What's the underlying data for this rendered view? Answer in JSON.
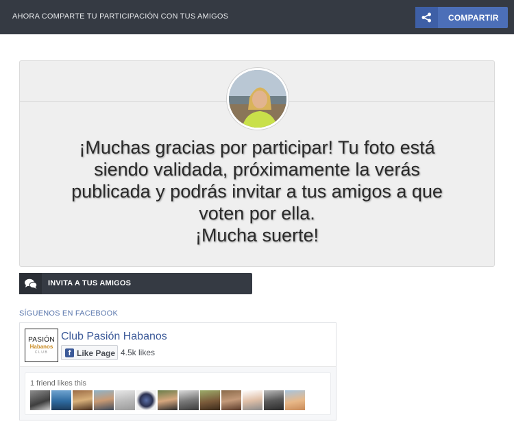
{
  "topbar": {
    "title": "AHORA COMPARTE TU PARTICIPACIÓN CON TUS AMIGOS",
    "share_label": "COMPARTIR"
  },
  "card": {
    "message_lines": [
      "¡Muchas gracias por participar! Tu foto está",
      "siendo validada, próximamente la verás",
      "publicada y podrás invitar a tus amigos a que",
      "voten por ella.",
      "¡Mucha suerte!"
    ]
  },
  "invite": {
    "label": "INVITA A TUS AMIGOS"
  },
  "follow": {
    "label": "SÍGUENOS EN FACEBOOK"
  },
  "facebook": {
    "logo": {
      "line1": "PASIÓN",
      "line2": "Habanos",
      "line3": "CLUB"
    },
    "page_name": "Club Pasión Habanos",
    "like_label": "Like Page",
    "likes_count": "4.5k likes",
    "friends_text": "1 friend likes this"
  },
  "colors": {
    "topbar": "#353a43",
    "share_button": "#4c6fb8",
    "facebook_blue": "#3b5998",
    "card_bg": "#efefef"
  },
  "icons": {
    "share": "share-icon",
    "invite": "chat-bubbles-icon",
    "facebook": "facebook-f-icon"
  }
}
